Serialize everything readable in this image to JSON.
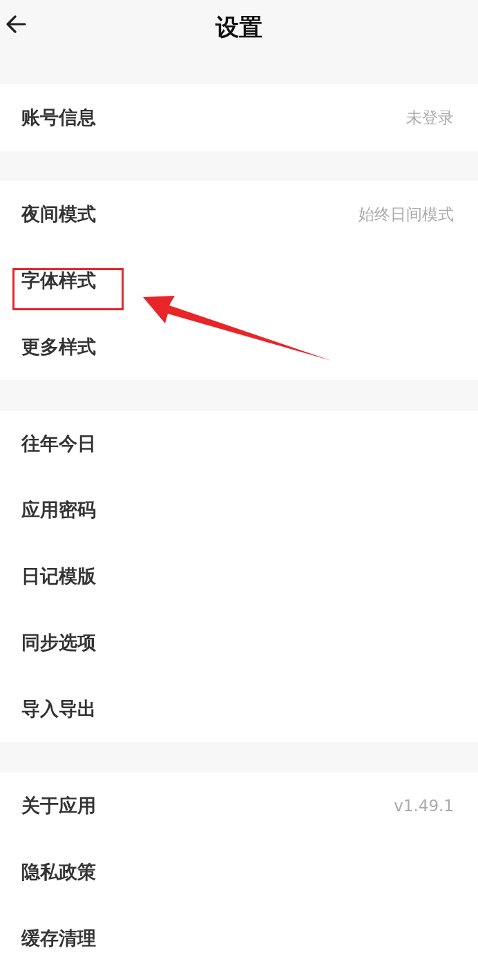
{
  "header": {
    "title": "设置"
  },
  "sections": [
    {
      "items": [
        {
          "label": "账号信息",
          "value": "未登录",
          "highlighted": false
        }
      ]
    },
    {
      "items": [
        {
          "label": "夜间模式",
          "value": "始终日间模式",
          "highlighted": false
        },
        {
          "label": "字体样式",
          "highlighted": true
        },
        {
          "label": "更多样式",
          "highlighted": false
        }
      ]
    },
    {
      "items": [
        {
          "label": "往年今日",
          "highlighted": false
        },
        {
          "label": "应用密码",
          "highlighted": false
        },
        {
          "label": "日记模版",
          "highlighted": false
        },
        {
          "label": "同步选项",
          "highlighted": false
        },
        {
          "label": "导入导出",
          "highlighted": false
        }
      ]
    },
    {
      "items": [
        {
          "label": "关于应用",
          "value": "v1.49.1",
          "highlighted": false
        },
        {
          "label": "隐私政策",
          "highlighted": false
        },
        {
          "label": "缓存清理",
          "highlighted": false
        }
      ]
    }
  ]
}
